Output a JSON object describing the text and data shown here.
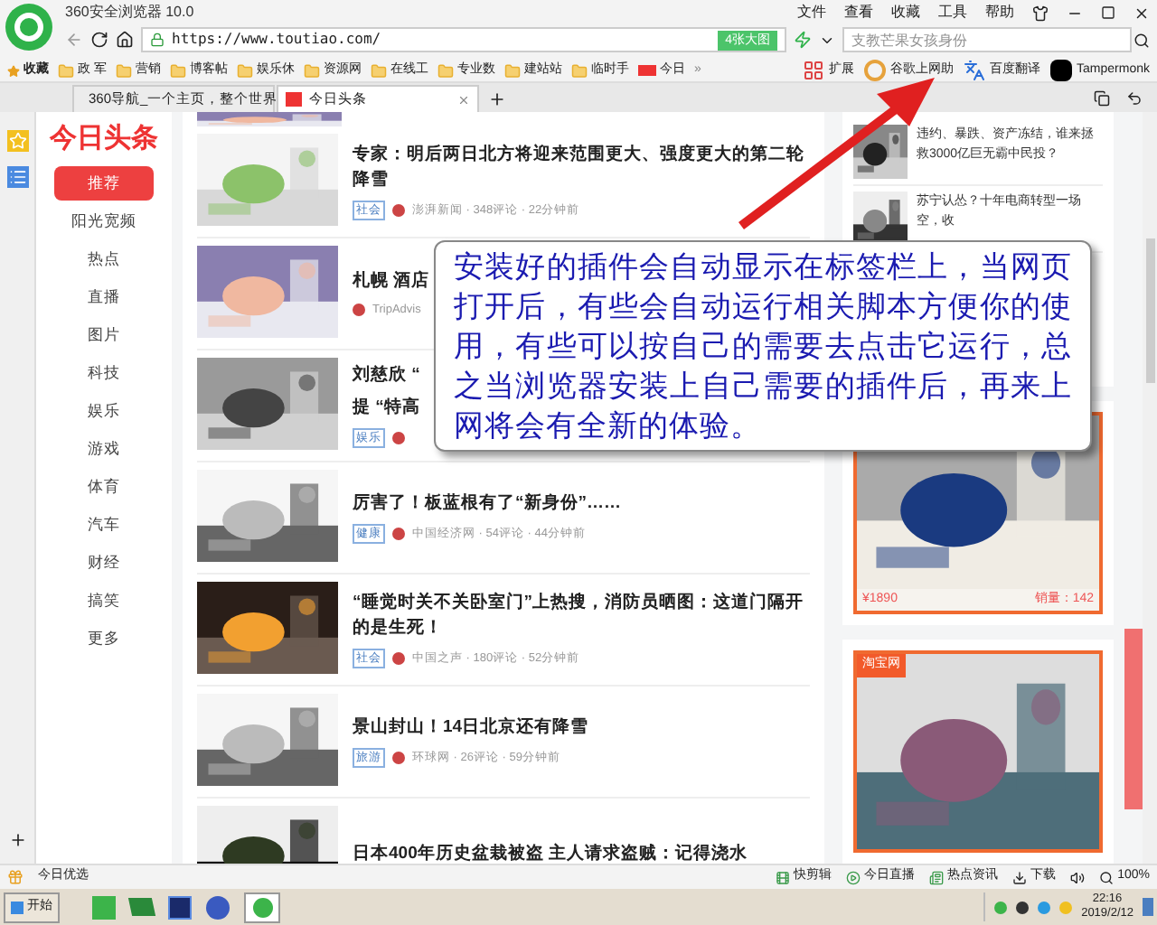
{
  "browser": {
    "title": "360安全浏览器 10.0",
    "menu": [
      "文件",
      "查看",
      "收藏",
      "工具",
      "帮助"
    ]
  },
  "address_bar": {
    "url": "https://www.toutiao.com/",
    "image_button": "4张大图",
    "search": {
      "placeholder": "支教芒果女孩身份"
    }
  },
  "bookmarks": {
    "favorites": "收藏",
    "items": [
      {
        "kind": "folder",
        "label": "政 军"
      },
      {
        "kind": "folder",
        "label": "营销"
      },
      {
        "kind": "folder",
        "label": "博客帖"
      },
      {
        "kind": "folder",
        "label": "娱乐休"
      },
      {
        "kind": "folder",
        "label": "资源网"
      },
      {
        "kind": "folder",
        "label": "在线工"
      },
      {
        "kind": "folder",
        "label": "专业数"
      },
      {
        "kind": "folder",
        "label": "建站站"
      },
      {
        "kind": "folder",
        "label": "临时手"
      },
      {
        "kind": "site",
        "label": "今日"
      }
    ],
    "more": "»",
    "extensions": [
      {
        "kind": "grid",
        "label": "扩展"
      },
      {
        "kind": "ring",
        "label": "谷歌上网助"
      },
      {
        "kind": "translate",
        "label": "百度翻译"
      },
      {
        "kind": "monkey",
        "label": "Tampermonk"
      }
    ]
  },
  "tabs": [
    {
      "label": "360导航_一个主页，整个世界",
      "selected": false
    },
    {
      "label": "今日头条",
      "selected": true
    }
  ],
  "sidebar": {
    "logo": "今日头条",
    "items": [
      {
        "label": "推荐",
        "selected": true
      },
      {
        "label": "阳光宽频",
        "selected": false
      },
      {
        "label": "热点",
        "selected": false
      },
      {
        "label": "直播",
        "selected": false
      },
      {
        "label": "图片",
        "selected": false
      },
      {
        "label": "科技",
        "selected": false
      },
      {
        "label": "娱乐",
        "selected": false
      },
      {
        "label": "游戏",
        "selected": false
      },
      {
        "label": "体育",
        "selected": false
      },
      {
        "label": "汽车",
        "selected": false
      },
      {
        "label": "财经",
        "selected": false
      },
      {
        "label": "搞笑",
        "selected": false
      },
      {
        "label": "更多",
        "selected": false
      }
    ]
  },
  "feed": [
    {
      "kind": "map",
      "title": "专家：明后两日北方将迎来范围更大、强度更大的第二轮降雪",
      "tag": "社会",
      "meta": "澎湃新闻 · 348评论 · 22分钟前"
    },
    {
      "kind": "dusk",
      "title": "札幌 酒店",
      "meta": "TripAdvis"
    },
    {
      "kind": "gate",
      "title": "刘慈欣 “",
      "title_2": "提 “特高",
      "tag": "娱乐"
    },
    {
      "kind": "doc",
      "title": "厉害了！板蓝根有了“新身份”……",
      "tag": "健康",
      "meta": "中国经济网 · 54评论 · 44分钟前"
    },
    {
      "kind": "door",
      "title": "“睡觉时关不关卧室门”上热搜，消防员晒图：这道门隔开的是生死！",
      "tag": "社会",
      "meta": "中国之声 · 180评论 · 52分钟前"
    },
    {
      "kind": "doc",
      "title": "景山封山！14日北京还有降雪",
      "tag": "旅游",
      "meta": "环球网 · 26评论 · 59分钟前"
    },
    {
      "kind": "tree",
      "title": "日本400年历史盆栽被盗 主人请求盗贼：记得浇水"
    }
  ],
  "side_news": [
    "违约、暴跌、资产冻结，谁来拯救3000亿巨无霸中民投？",
    "苏宁认怂？十年电商转型一场空，收"
  ],
  "ads": [
    {
      "price": "¥1890",
      "sales": "销量：142"
    },
    {
      "badge": "淘宝网"
    }
  ],
  "callout": {
    "text": "安装好的插件会自动显示在标签栏上，当网页打开后，有些会自动运行相关脚本方便你的使用，有些可以按自己的需要去点击它运行，总之当浏览器安装上自己需要的插件后，再来上网将会有全新的体验。"
  },
  "status_bar": {
    "left": "今日优选",
    "items": [
      "快剪辑",
      "今日直播",
      "热点资讯"
    ],
    "download": "下载",
    "zoom": "100%"
  },
  "taskbar": {
    "start": "开始",
    "time": "22:16",
    "date": "2019/2/12"
  }
}
